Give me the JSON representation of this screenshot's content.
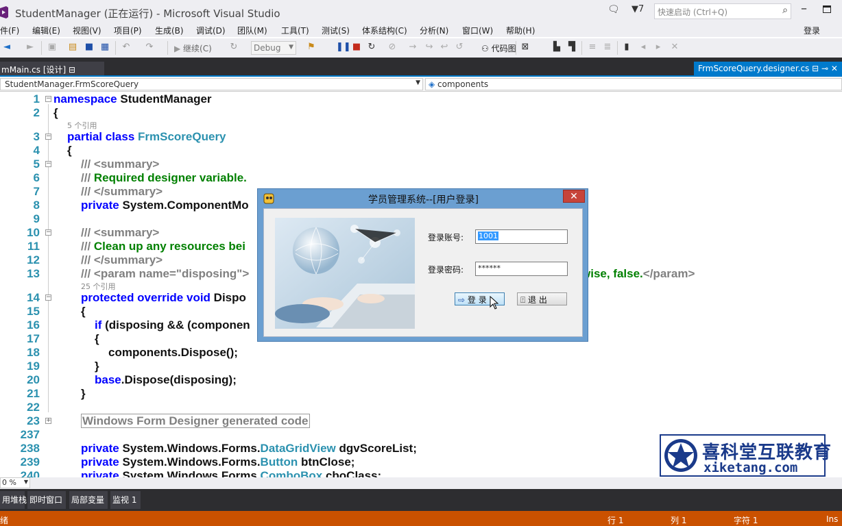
{
  "window": {
    "title": "StudentManager (正在运行) - Microsoft Visual Studio",
    "notifications_count": "7",
    "quick_launch_placeholder": "快速启动 (Ctrl+Q)",
    "sign_in": "登录"
  },
  "menu": [
    "件(F)",
    "编辑(E)",
    "视图(V)",
    "项目(P)",
    "生成(B)",
    "调试(D)",
    "团队(M)",
    "工具(T)",
    "测试(S)",
    "体系结构(C)",
    "分析(N)",
    "窗口(W)",
    "帮助(H)"
  ],
  "toolbar": {
    "continue_label": "继续(C)",
    "config": "Debug",
    "codemap_label": "代码图"
  },
  "tabs": {
    "left": "mMain.cs [设计]",
    "right": "FrmScoreQuery.designer.cs"
  },
  "navbar": {
    "class_path": "StudentManager.FrmScoreQuery",
    "member": "components"
  },
  "code": {
    "line_numbers": [
      "1",
      "2",
      "3",
      "4",
      "5",
      "6",
      "7",
      "8",
      "9",
      "10",
      "11",
      "12",
      "13",
      "14",
      "15",
      "16",
      "17",
      "18",
      "19",
      "20",
      "21",
      "22",
      "23",
      "237",
      "238",
      "239",
      "240"
    ],
    "refs": {
      "r1": "5 个引用",
      "r2": "25 个引用"
    },
    "kw_namespace": "namespace",
    "ns_name": "StudentManager",
    "brace_open": "{",
    "brace_close": "}",
    "kw_partial_class": "partial class",
    "class_name": "FrmScoreQuery",
    "doc_prefix": "///",
    "summary_open": "<summary>",
    "summary_close": "</summary>",
    "comment_required": "Required designer variable.",
    "l8_private": "private",
    "l8_rest": "System.ComponentMo",
    "comment_cleanup": "Clean up any resources bei",
    "l13_param": "<param name=\"disposing\">",
    "l13_tail_text": "wise, false.",
    "l13_tail_tag": "</param>",
    "l14_kw": "protected override void",
    "l14_rest": "Dispo",
    "l16_if": "if",
    "l16_rest": "(disposing && (componen",
    "l18": "components.Dispose();",
    "l20_base": "base",
    "l20_rest": ".Dispose(disposing);",
    "region": "Windows Form Designer generated code",
    "l238_pre": "System.Windows.Forms.",
    "l238_type": "DataGridView",
    "l238_name": "dgvScoreList;",
    "l239_type": "Button",
    "l239_name": "btnClose;",
    "l240_type": "ComboBox",
    "l240_name": "cboClass;"
  },
  "zoom": "0 %",
  "bottom_tabs": [
    "用堆栈",
    "即时窗口",
    "局部变量",
    "监视 1"
  ],
  "status": {
    "left": "绪",
    "row": "行 1",
    "col": "列 1",
    "char": "字符 1",
    "mode": "Ins"
  },
  "dialog": {
    "title": "学员管理系统--[用户登录]",
    "close": "✕",
    "account_label": "登录账号:",
    "account_value": "1001",
    "password_label": "登录密码:",
    "password_value": "******",
    "login_button": "登  录",
    "exit_button": "退  出"
  },
  "watermark": {
    "cn": "喜科堂互联教育",
    "en": "xiketang.com"
  },
  "colors": {
    "accent": "#007acc",
    "status_bar": "#ca5100",
    "keyword": "#0000ff",
    "type": "#2b91af",
    "comment": "#008000"
  }
}
